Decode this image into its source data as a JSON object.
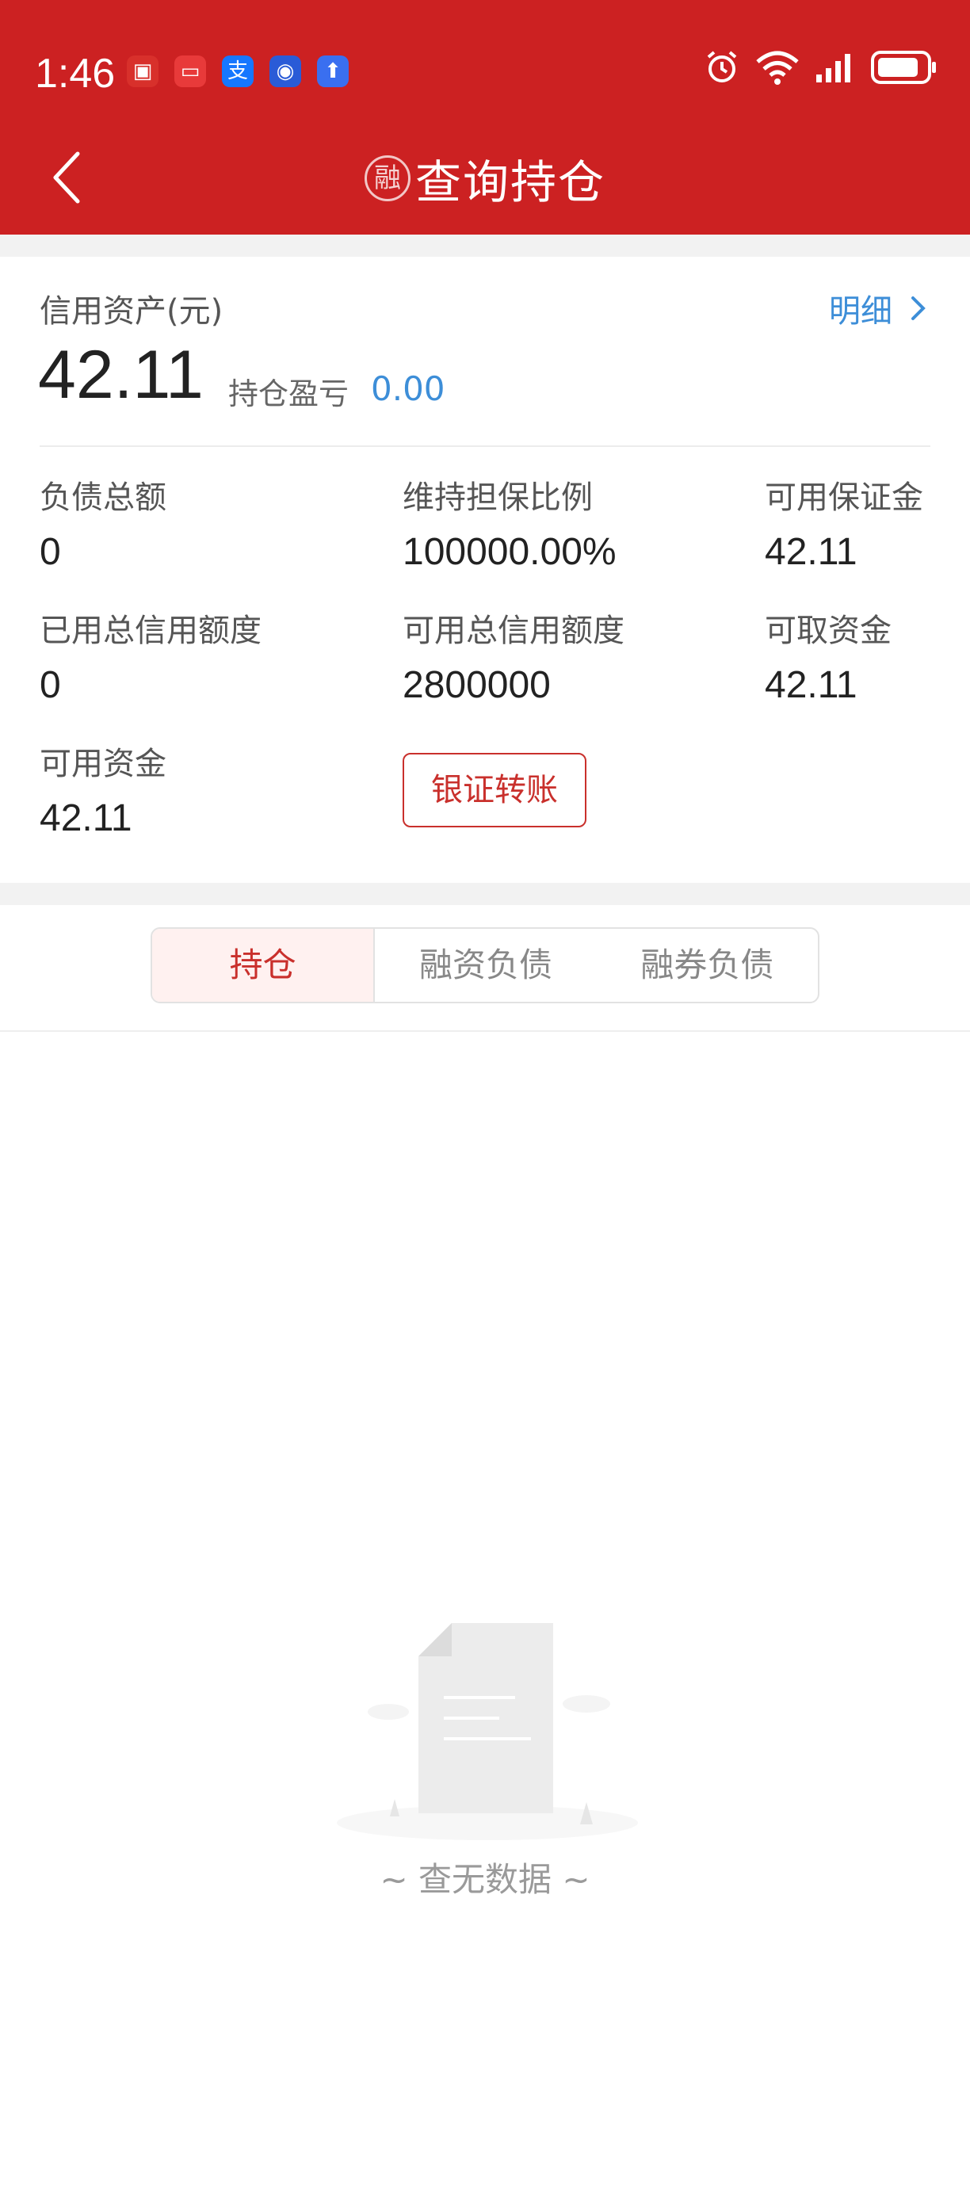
{
  "status_bar": {
    "time": "1:46",
    "apps": [
      {
        "name": "news-app-icon",
        "glyph": "▣",
        "color": "#d8302b"
      },
      {
        "name": "reader-app-icon",
        "glyph": "▭",
        "color": "#e83a3a"
      },
      {
        "name": "alipay-icon",
        "glyph": "支",
        "color": "#1677ff"
      },
      {
        "name": "bank-app-icon",
        "glyph": "◉",
        "color": "#2a5bd7"
      },
      {
        "name": "upload-app-icon",
        "glyph": "⬆",
        "color": "#3a6ff0"
      }
    ]
  },
  "header": {
    "badge": "融",
    "title": "查询持仓"
  },
  "summary": {
    "asset_label": "信用资产(元)",
    "asset_value": "42.11",
    "detail_link": "明细",
    "pl_label": "持仓盈亏",
    "pl_value": "0.00"
  },
  "metrics": [
    {
      "label": "负债总额",
      "value": "0"
    },
    {
      "label": "维持担保比例",
      "value": "100000.00%"
    },
    {
      "label": "可用保证金",
      "value": "42.11"
    },
    {
      "label": "已用总信用额度",
      "value": "0"
    },
    {
      "label": "可用总信用额度",
      "value": "2800000"
    },
    {
      "label": "可取资金",
      "value": "42.11"
    },
    {
      "label": "可用资金",
      "value": "42.11"
    }
  ],
  "transfer_button": "银证转账",
  "tabs": [
    {
      "label": "持仓",
      "active": true
    },
    {
      "label": "融资负债",
      "active": false
    },
    {
      "label": "融券负债",
      "active": false
    }
  ],
  "empty_state": {
    "text": "~ 查无数据 ~"
  },
  "colors": {
    "brand_red": "#cc2122",
    "link_blue": "#3d8ed8",
    "button_red": "#c9302c"
  }
}
